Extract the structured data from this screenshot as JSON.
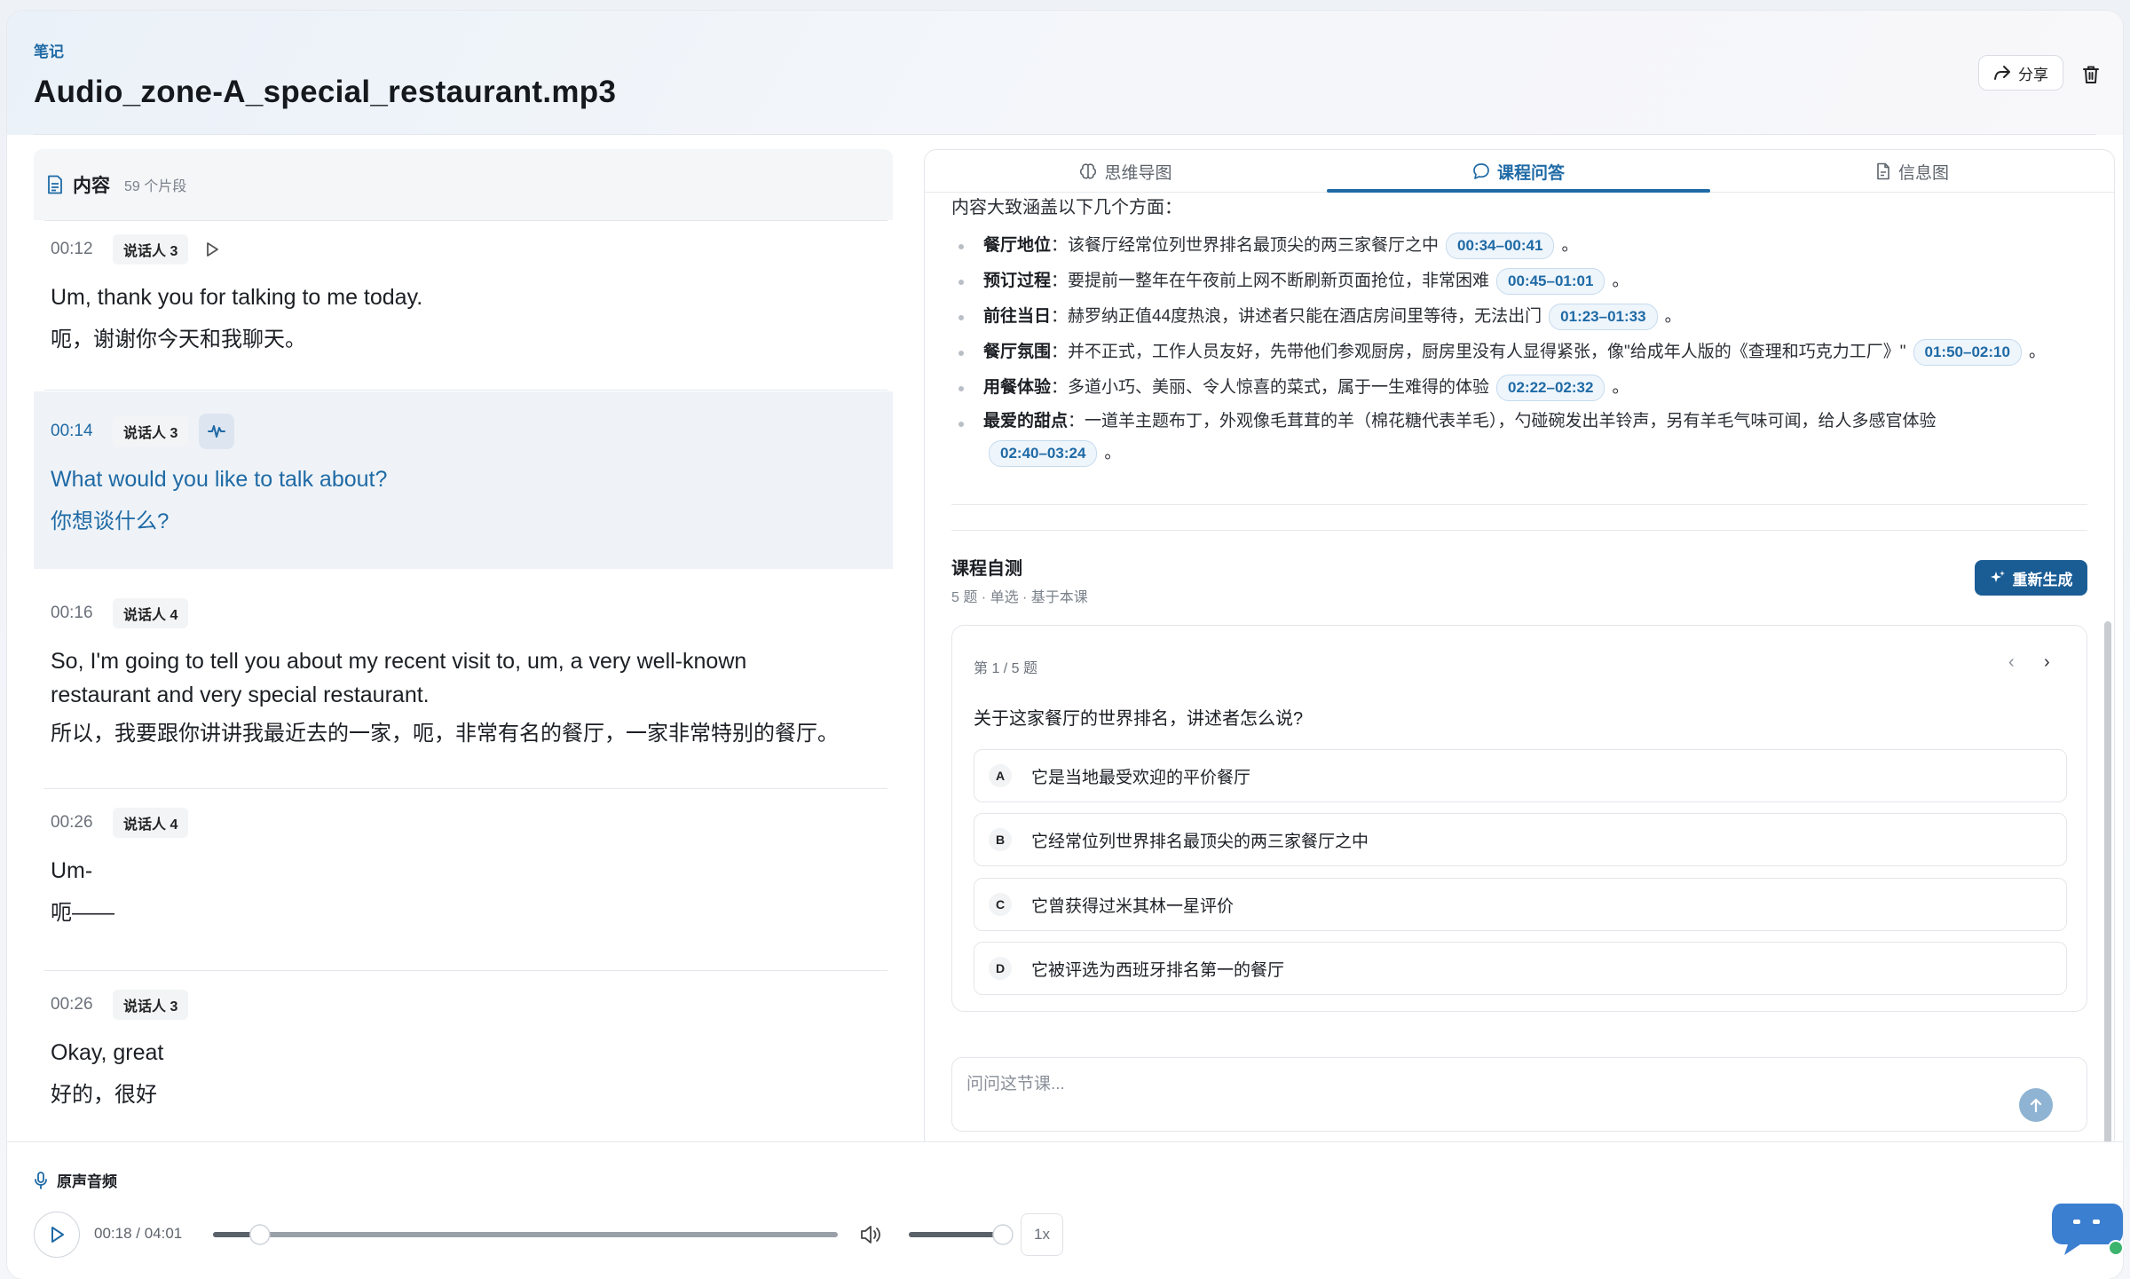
{
  "header": {
    "breadcrumb": "笔记",
    "title": "Audio_zone-A_special_restaurant.mp3",
    "share_label": "分享"
  },
  "transcript": {
    "heading": "内容",
    "segment_count": "59 个片段",
    "segments": [
      {
        "time": "00:12",
        "speaker": "说话人 3",
        "en": "Um, thank you for talking to me today.",
        "zh": "呃，谢谢你今天和我聊天。",
        "active": false
      },
      {
        "time": "00:14",
        "speaker": "说话人 3",
        "en": "What would you like to talk about?",
        "zh": "你想谈什么?",
        "active": true
      },
      {
        "time": "00:16",
        "speaker": "说话人 4",
        "en": "So, I'm going to tell you about my recent visit to, um, a very well-known restaurant and very special restaurant.",
        "zh": "所以，我要跟你讲讲我最近去的一家，呃，非常有名的餐厅，一家非常特别的餐厅。",
        "active": false
      },
      {
        "time": "00:26",
        "speaker": "说话人 4",
        "en": "Um-",
        "zh": "呃——",
        "active": false
      },
      {
        "time": "00:26",
        "speaker": "说话人 3",
        "en": "Okay, great",
        "zh": "好的，很好",
        "active": false
      }
    ]
  },
  "tabs": [
    {
      "label": "思维导图",
      "icon": "brain-icon",
      "active": false
    },
    {
      "label": "课程问答",
      "icon": "chat-bubble-icon",
      "active": true
    },
    {
      "label": "信息图",
      "icon": "document-icon",
      "active": false
    }
  ],
  "summary": {
    "intro": "内容大致涵盖以下几个方面：",
    "points": [
      {
        "label": "餐厅地位",
        "text": "：该餐厅经常位列世界排名最顶尖的两三家餐厅之中",
        "time": "00:34–00:41"
      },
      {
        "label": "预订过程",
        "text": "：要提前一整年在午夜前上网不断刷新页面抢位，非常困难",
        "time": "00:45–01:01"
      },
      {
        "label": "前往当日",
        "text": "：赫罗纳正值44度热浪，讲述者只能在酒店房间里等待，无法出门",
        "time": "01:23–01:33"
      },
      {
        "label": "餐厅氛围",
        "text": "：并不正式，工作人员友好，先带他们参观厨房，厨房里没有人显得紧张，像\"给成年人版的《查理和巧克力工厂》\"",
        "time": "01:50–02:10"
      },
      {
        "label": "用餐体验",
        "text": "：多道小巧、美丽、令人惊喜的菜式，属于一生难得的体验",
        "time": "02:22–02:32"
      },
      {
        "label": "最爱的甜点",
        "text": "：一道羊主题布丁，外观像毛茸茸的羊（棉花糖代表羊毛），勺碰碗发出羊铃声，另有羊毛气味可闻，给人多感官体验",
        "time": "02:40–03:24"
      }
    ],
    "period": "。"
  },
  "quiz": {
    "title": "课程自测",
    "subtitle": "5 题 · 单选 · 基于本课",
    "regenerate_label": "重新生成",
    "progress": "第 1 / 5 题",
    "prev": "‹",
    "next": "›",
    "question": "关于这家餐厅的世界排名，讲述者怎么说?",
    "options": [
      {
        "letter": "A",
        "text": "它是当地最受欢迎的平价餐厅"
      },
      {
        "letter": "B",
        "text": "它经常位列世界排名最顶尖的两三家餐厅之中"
      },
      {
        "letter": "C",
        "text": "它曾获得过米其林一星评价"
      },
      {
        "letter": "D",
        "text": "它被评选为西班牙排名第一的餐厅"
      }
    ]
  },
  "ask": {
    "placeholder": "问问这节课..."
  },
  "player": {
    "label": "原声音频",
    "time": "00:18 / 04:01",
    "progress": 0.075,
    "volume": 1.0,
    "speed": "1x"
  },
  "colors": {
    "accent": "#1f6aa5",
    "button": "#1a5d95",
    "active_bg": "#eff3f7"
  }
}
